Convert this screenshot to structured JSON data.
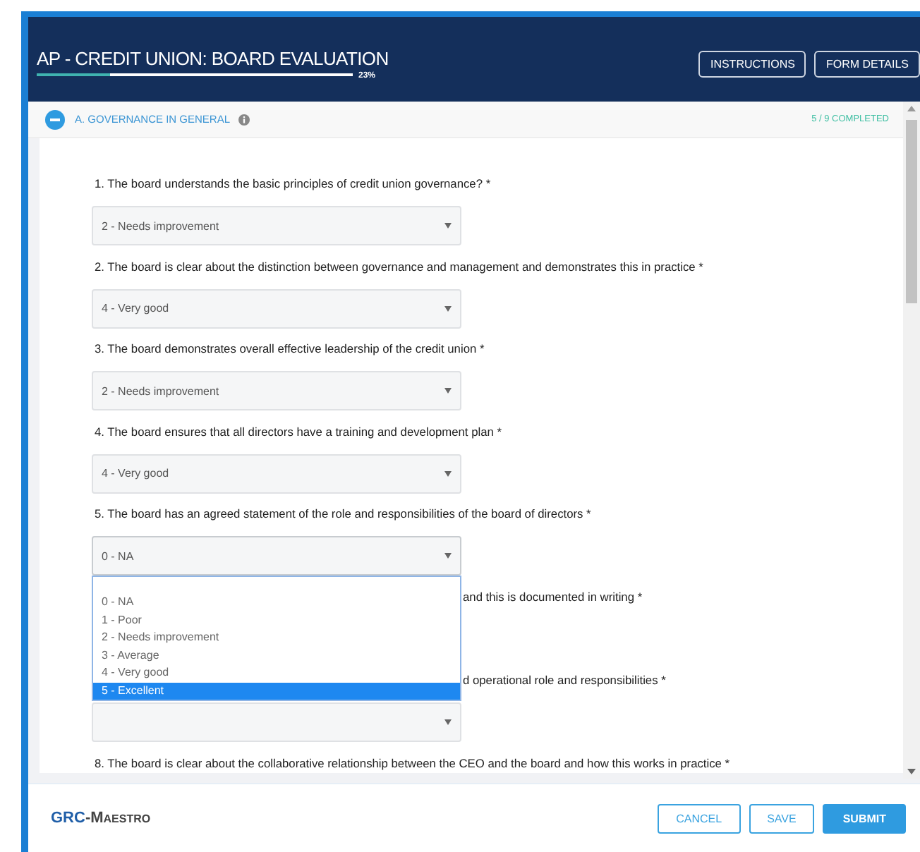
{
  "header": {
    "title": "AP - CREDIT UNION: BOARD EVALUATION",
    "progress": {
      "level": 0.23,
      "label": "23%"
    },
    "buttons": [
      "INSTRUCTIONS",
      "FORM DETAILS"
    ]
  },
  "section": {
    "title": "A. GOVERNANCE IN GENERAL",
    "expanded": true,
    "status": "5 / 9 COMPLETED"
  },
  "questions": [
    {
      "kind": "full",
      "text": "1. The board understands the basic principles of credit union governance? *",
      "value": "2 - Needs improvement"
    },
    {
      "kind": "full",
      "text": "2. The board is clear about the distinction between governance and management and demonstrates this in practice *",
      "value": "4 - Very good"
    },
    {
      "kind": "full",
      "text": "3. The board demonstrates overall effective leadership of the credit union *",
      "value": "2 - Needs improvement"
    },
    {
      "kind": "full",
      "text": "4. The board ensures that all directors have a training and development plan *",
      "value": "4 - Very good"
    },
    {
      "kind": "full",
      "text": "5. The board has an agreed statement of the role and responsibilities of the board of directors *",
      "value": "0 - NA",
      "open": true,
      "options": [
        {
          "label": "0 - NA",
          "highlighted": false
        },
        {
          "label": "1 - Poor",
          "highlighted": false
        },
        {
          "label": "2 - Needs improvement",
          "highlighted": false
        },
        {
          "label": "3 - Average",
          "highlighted": false
        },
        {
          "label": "4 - Very good",
          "highlighted": false
        },
        {
          "label": "5 - Excellent",
          "highlighted": true
        }
      ]
    },
    {
      "kind": "covered",
      "text": "and this is documented in writing *"
    },
    {
      "kind": "partial",
      "text": "d operational role and responsibilities *"
    },
    {
      "kind": "full",
      "text": "8. The board is clear about the collaborative relationship between the CEO and the board and how this works in practice *"
    }
  ],
  "footer": {
    "logo_main": "GRC",
    "logo_rest": "-Maestro",
    "buttons": [
      {
        "label": "CANCEL",
        "kind": "outline"
      },
      {
        "label": "SAVE",
        "kind": "outline"
      },
      {
        "label": "SUBMIT",
        "kind": "primary"
      }
    ]
  }
}
